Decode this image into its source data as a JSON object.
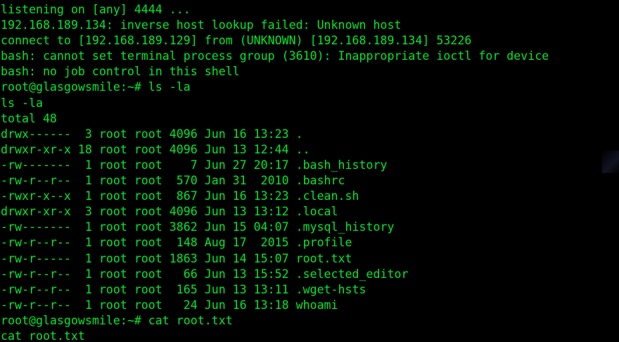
{
  "terminal": {
    "text_color": "#00e82b",
    "background_color": "#000000",
    "lines": [
      "listening on [any] 4444 ...",
      "192.168.189.134: inverse host lookup failed: Unknown host",
      "connect to [192.168.189.129] from (UNKNOWN) [192.168.189.134] 53226",
      "bash: cannot set terminal process group (3610): Inappropriate ioctl for device",
      "bash: no job control in this shell",
      "root@glasgowsmile:~# ls -la",
      "ls -la",
      "total 48",
      "drwx------  3 root root 4096 Jun 16 13:23 .",
      "drwxr-xr-x 18 root root 4096 Jun 13 12:44 ..",
      "-rw-------  1 root root    7 Jun 27 20:17 .bash_history",
      "-rw-r--r--  1 root root  570 Jan 31  2010 .bashrc",
      "-rwxr-x--x  1 root root  867 Jun 16 13:23 .clean.sh",
      "drwxr-xr-x  3 root root 4096 Jun 13 13:12 .local",
      "-rw-------  1 root root 3862 Jun 15 04:07 .mysql_history",
      "-rw-r--r--  1 root root  148 Aug 17  2015 .profile",
      "-rw-r-----  1 root root 1863 Jun 14 15:07 root.txt",
      "-rw-r--r--  1 root root   66 Jun 13 15:52 .selected_editor",
      "-rw-r--r--  1 root root  165 Jun 13 13:11 .wget-hsts",
      "-rw-r--r--  1 root root   24 Jun 16 13:18 whoami",
      "root@glasgowsmile:~# cat root.txt",
      "cat root.txt"
    ]
  }
}
